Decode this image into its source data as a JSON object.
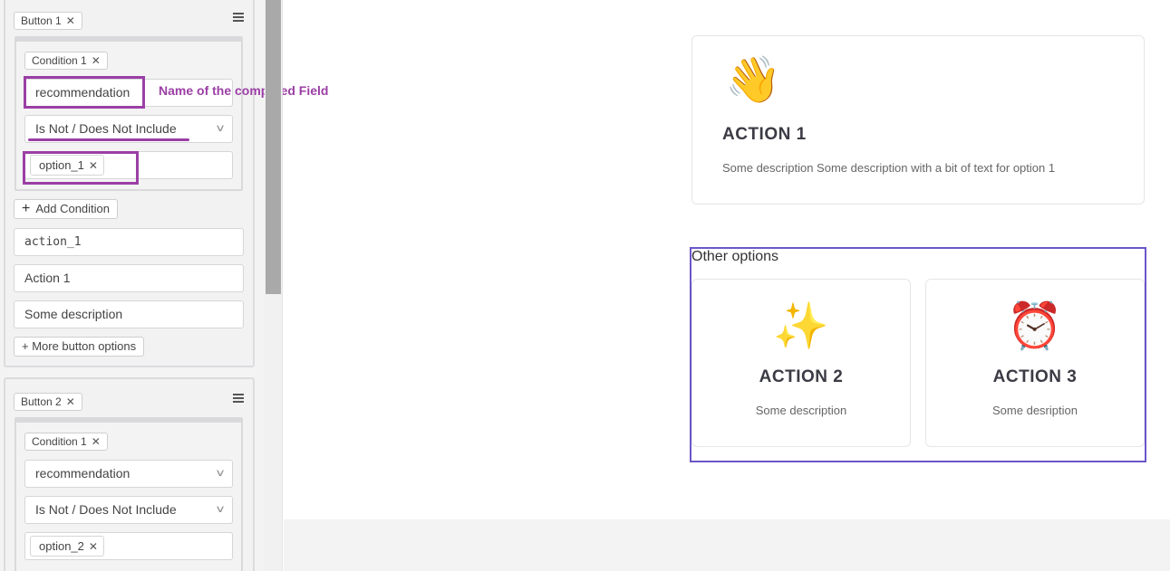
{
  "buttons": [
    {
      "chip_label": "Button 1",
      "condition_chip": "Condition 1",
      "field_value": "recommendation",
      "operator_value": "Is Not / Does Not Include",
      "option_tag": "option_1",
      "add_condition_label": "Add Condition",
      "action_id": "action_1",
      "action_title": "Action 1",
      "action_description": "Some description",
      "more_options_label": "+ More button options"
    },
    {
      "chip_label": "Button 2",
      "condition_chip": "Condition 1",
      "field_value": "recommendation",
      "operator_value": "Is Not / Does Not Include",
      "option_tag": "option_2"
    }
  ],
  "annotation": {
    "label": "Name of the computed Field",
    "color": "#9b3fa5"
  },
  "preview": {
    "main_card": {
      "emoji": "👋",
      "title": "ACTION 1",
      "description": "Some description Some description with a bit of text for option 1"
    },
    "other_options_label": "Other options",
    "other_cards": [
      {
        "emoji": "✨",
        "title": "ACTION 2",
        "description": "Some description"
      },
      {
        "emoji": "⏰",
        "title": "ACTION 3",
        "description": "Some desription"
      }
    ],
    "highlight_color": "#6c56c9"
  },
  "icons": {
    "close": "close-icon",
    "menu": "hamburger-menu-icon",
    "chevron": "chevron-down-icon",
    "plus": "plus-icon"
  }
}
